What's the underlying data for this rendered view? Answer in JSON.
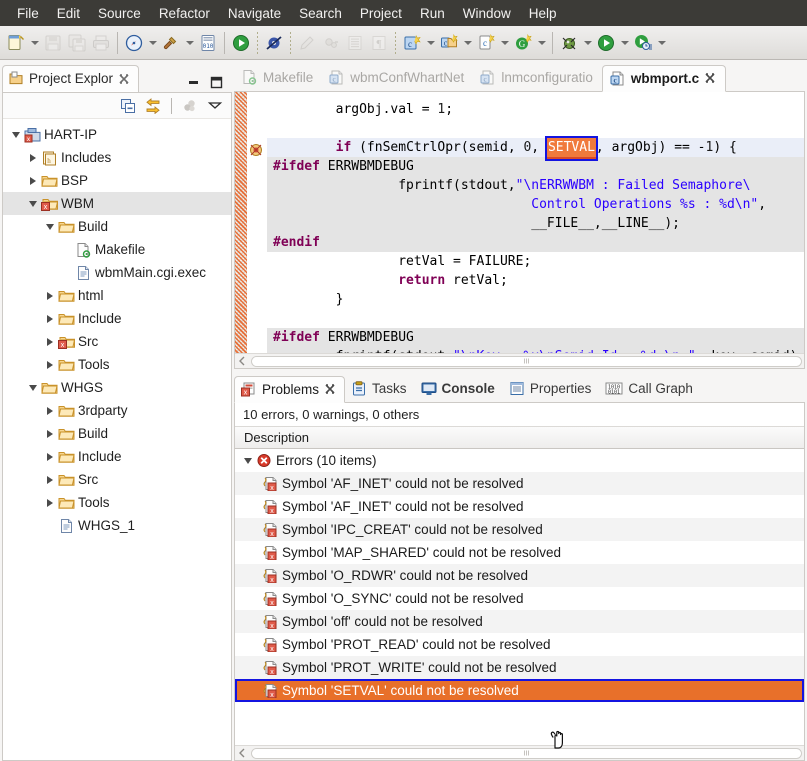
{
  "menubar": {
    "items": [
      "File",
      "Edit",
      "Source",
      "Refactor",
      "Navigate",
      "Search",
      "Project",
      "Run",
      "Window",
      "Help"
    ]
  },
  "toolbar": {
    "groups": [
      {
        "items": [
          {
            "name": "new-file-icon",
            "label": "New",
            "dropdown": true,
            "enabled": true
          },
          {
            "name": "save-icon",
            "label": "Save",
            "dropdown": false,
            "enabled": false
          },
          {
            "name": "save-all-icon",
            "label": "Save All",
            "dropdown": false,
            "enabled": false
          },
          {
            "name": "print-icon",
            "label": "Print",
            "dropdown": false,
            "enabled": false
          }
        ]
      },
      {
        "items": [
          {
            "name": "build-all-icon",
            "label": "Build All",
            "dropdown": true,
            "enabled": true
          },
          {
            "name": "build-hammer-icon",
            "label": "Build",
            "dropdown": true,
            "enabled": true
          },
          {
            "name": "binary-icon",
            "label": "Open Binary",
            "dropdown": false,
            "enabled": true
          }
        ]
      },
      {
        "items": [
          {
            "name": "run-icon",
            "label": "Run",
            "dropdown": false,
            "enabled": true
          }
        ]
      },
      {
        "items": [
          {
            "name": "skip-breakpoints-icon",
            "label": "Skip All Breakpoints",
            "dropdown": false,
            "enabled": true
          }
        ]
      },
      {
        "items": [
          {
            "name": "pencil-icon",
            "label": "Edit",
            "dropdown": false,
            "enabled": false
          },
          {
            "name": "link-icon",
            "label": "Link",
            "dropdown": false,
            "enabled": false
          },
          {
            "name": "outline-icon",
            "label": "Outline",
            "dropdown": false,
            "enabled": false
          },
          {
            "name": "paragraph-icon",
            "label": "Paragraph",
            "dropdown": false,
            "enabled": false
          }
        ]
      },
      {
        "items": [
          {
            "name": "new-c-project-icon",
            "label": "New C/C++ Project",
            "dropdown": true,
            "enabled": true
          },
          {
            "name": "new-c-folder-icon",
            "label": "New C/C++ Source Folder",
            "dropdown": true,
            "enabled": true
          },
          {
            "name": "new-c-file-icon",
            "label": "New C/C++ Source File",
            "dropdown": true,
            "enabled": true
          },
          {
            "name": "new-class-icon",
            "label": "New Class",
            "dropdown": true,
            "enabled": true
          }
        ]
      },
      {
        "items": [
          {
            "name": "debug-icon",
            "label": "Debug",
            "dropdown": true,
            "enabled": true
          },
          {
            "name": "run-configs-icon",
            "label": "Run",
            "dropdown": true,
            "enabled": true
          },
          {
            "name": "external-tools-icon",
            "label": "External Tools",
            "dropdown": true,
            "enabled": true
          }
        ]
      }
    ]
  },
  "project_explorer": {
    "title": "Project Explor",
    "close_icon": "close-icon",
    "view_icon": "project-explorer-icon",
    "minimize_label": "Minimize",
    "maximize_label": "Maximize",
    "toolbar": [
      {
        "name": "collapse-all-icon",
        "label": "Collapse All"
      },
      {
        "name": "link-with-editor-icon",
        "label": "Link with Editor"
      },
      {
        "name": "view-menu-filter-icon",
        "label": "Filters"
      },
      {
        "name": "view-menu-icon",
        "label": "View Menu"
      }
    ],
    "tree": [
      {
        "label": "HART-IP",
        "indent": 0,
        "twisty": "down",
        "icon": "c-project-icon",
        "selected": false
      },
      {
        "label": "Includes",
        "indent": 1,
        "twisty": "right",
        "icon": "includes-icon",
        "selected": false
      },
      {
        "label": "BSP",
        "indent": 1,
        "twisty": "right",
        "icon": "folder-icon",
        "selected": false
      },
      {
        "label": "WBM",
        "indent": 1,
        "twisty": "down",
        "icon": "folder-error-icon",
        "selected": true
      },
      {
        "label": "Build",
        "indent": 2,
        "twisty": "down",
        "icon": "folder-icon",
        "selected": false
      },
      {
        "label": "Makefile",
        "indent": 3,
        "twisty": "none",
        "icon": "makefile-icon",
        "selected": false
      },
      {
        "label": "wbmMain.cgi.exec",
        "indent": 3,
        "twisty": "none",
        "icon": "file-icon",
        "selected": false
      },
      {
        "label": "html",
        "indent": 2,
        "twisty": "right",
        "icon": "folder-icon",
        "selected": false
      },
      {
        "label": "Include",
        "indent": 2,
        "twisty": "right",
        "icon": "folder-icon",
        "selected": false
      },
      {
        "label": "Src",
        "indent": 2,
        "twisty": "right",
        "icon": "folder-error-icon",
        "selected": false
      },
      {
        "label": "Tools",
        "indent": 2,
        "twisty": "right",
        "icon": "folder-icon",
        "selected": false
      },
      {
        "label": "WHGS",
        "indent": 1,
        "twisty": "down",
        "icon": "folder-icon",
        "selected": false
      },
      {
        "label": "3rdparty",
        "indent": 2,
        "twisty": "right",
        "icon": "folder-icon",
        "selected": false
      },
      {
        "label": "Build",
        "indent": 2,
        "twisty": "right",
        "icon": "folder-icon",
        "selected": false
      },
      {
        "label": "Include",
        "indent": 2,
        "twisty": "right",
        "icon": "folder-icon",
        "selected": false
      },
      {
        "label": "Src",
        "indent": 2,
        "twisty": "right",
        "icon": "folder-icon",
        "selected": false
      },
      {
        "label": "Tools",
        "indent": 2,
        "twisty": "right",
        "icon": "folder-icon",
        "selected": false
      },
      {
        "label": "WHGS_1",
        "indent": 2,
        "twisty": "none",
        "icon": "file-icon",
        "selected": false
      }
    ]
  },
  "editor": {
    "tabs": [
      {
        "label": "Makefile",
        "icon": "makefile-icon",
        "active": false,
        "closable": false
      },
      {
        "label": "wbmConfWhartNet",
        "icon": "c-file-icon",
        "active": false,
        "closable": false
      },
      {
        "label": "lnmconfiguratio",
        "icon": "c-file-icon",
        "active": false,
        "closable": false
      },
      {
        "label": "wbmport.c",
        "icon": "c-file-icon",
        "active": true,
        "closable": true
      }
    ],
    "occurrence_token": "SETVAL",
    "lines": [
      {
        "bg": "none",
        "segments": [
          {
            "t": "        argObj.val = ",
            "c": "plain"
          },
          {
            "t": "1",
            "c": "num"
          },
          {
            "t": ";",
            "c": "plain"
          }
        ]
      },
      {
        "bg": "none",
        "segments": [
          {
            "t": "",
            "c": "plain"
          }
        ]
      },
      {
        "bg": "hl",
        "segments": [
          {
            "t": "        ",
            "c": "plain"
          },
          {
            "t": "if",
            "c": "kw"
          },
          {
            "t": " (fnSemCtrlOpr(semid, ",
            "c": "plain"
          },
          {
            "t": "0",
            "c": "num"
          },
          {
            "t": ", ",
            "c": "plain"
          },
          {
            "t": "SETVAL",
            "c": "occ"
          },
          {
            "t": ", argObj) == -",
            "c": "plain"
          },
          {
            "t": "1",
            "c": "num"
          },
          {
            "t": ") {",
            "c": "plain"
          }
        ]
      },
      {
        "bg": "gray",
        "segments": [
          {
            "t": "#ifdef",
            "c": "pp"
          },
          {
            "t": " ERRWBMDEBUG",
            "c": "plain"
          }
        ]
      },
      {
        "bg": "gray",
        "segments": [
          {
            "t": "                fprintf(stdout,",
            "c": "plain"
          },
          {
            "t": "\"\\nERRWWBM : Failed Semaphore\\",
            "c": "str"
          }
        ]
      },
      {
        "bg": "gray",
        "segments": [
          {
            "t": "                                 ",
            "c": "plain"
          },
          {
            "t": "Control Operations %s : %d\\n\"",
            "c": "str"
          },
          {
            "t": ",",
            "c": "plain"
          }
        ]
      },
      {
        "bg": "gray",
        "segments": [
          {
            "t": "                                 __FILE__,__LINE__);",
            "c": "plain"
          }
        ]
      },
      {
        "bg": "gray",
        "segments": [
          {
            "t": "#endif",
            "c": "pp"
          }
        ]
      },
      {
        "bg": "none",
        "segments": [
          {
            "t": "                retVal = FAILURE;",
            "c": "plain"
          }
        ]
      },
      {
        "bg": "none",
        "segments": [
          {
            "t": "                ",
            "c": "plain"
          },
          {
            "t": "return",
            "c": "kw"
          },
          {
            "t": " retVal;",
            "c": "plain"
          }
        ]
      },
      {
        "bg": "none",
        "segments": [
          {
            "t": "        }",
            "c": "plain"
          }
        ]
      },
      {
        "bg": "none",
        "segments": [
          {
            "t": "",
            "c": "plain"
          }
        ]
      },
      {
        "bg": "gray",
        "segments": [
          {
            "t": "#ifdef",
            "c": "pp"
          },
          {
            "t": " ERRWBMDEBUG",
            "c": "plain"
          }
        ]
      },
      {
        "bg": "gray",
        "segments": [
          {
            "t": "        fprintf(stdout,",
            "c": "plain"
          },
          {
            "t": "\"\\nKey : %x\\nSemid Id : %d \\n \"",
            "c": "str"
          },
          {
            "t": ", key, semid);",
            "c": "plain"
          }
        ]
      }
    ]
  },
  "problems": {
    "tabs": [
      {
        "label": "Problems",
        "icon": "problems-icon",
        "active": true,
        "bold": false,
        "closable": true
      },
      {
        "label": "Tasks",
        "icon": "tasks-icon",
        "active": false,
        "bold": false,
        "closable": false
      },
      {
        "label": "Console",
        "icon": "console-icon",
        "active": false,
        "bold": true,
        "closable": false
      },
      {
        "label": "Properties",
        "icon": "properties-icon",
        "active": false,
        "bold": false,
        "closable": false
      },
      {
        "label": "Call Graph",
        "icon": "call-graph-icon",
        "active": false,
        "bold": false,
        "closable": false
      }
    ],
    "summary": "10 errors, 0 warnings, 0 others",
    "column_header": "Description",
    "group": {
      "label": "Errors (10 items)",
      "icon": "error-icon",
      "expanded": true
    },
    "items": [
      {
        "label": "Symbol 'AF_INET' could not be resolved",
        "selected": false
      },
      {
        "label": "Symbol 'AF_INET' could not be resolved",
        "selected": false
      },
      {
        "label": "Symbol 'IPC_CREAT' could not be resolved",
        "selected": false
      },
      {
        "label": "Symbol 'MAP_SHARED' could not be resolved",
        "selected": false
      },
      {
        "label": "Symbol 'O_RDWR' could not be resolved",
        "selected": false
      },
      {
        "label": "Symbol 'O_SYNC' could not be resolved",
        "selected": false
      },
      {
        "label": "Symbol 'off' could not be resolved",
        "selected": false
      },
      {
        "label": "Symbol 'PROT_READ' could not be resolved",
        "selected": false
      },
      {
        "label": "Symbol 'PROT_WRITE' could not be resolved",
        "selected": false
      },
      {
        "label": "Symbol 'SETVAL' could not be resolved",
        "selected": true
      }
    ]
  },
  "colors": {
    "menubar_bg": "#3c3b37",
    "selection_orange": "#e8702a",
    "focus_blue": "#1414e0",
    "keyword_purple": "#7f0055",
    "string_blue": "#2a00ff",
    "line_highlight": "#eaeef8",
    "inactive_block": "#e4e4e4"
  }
}
